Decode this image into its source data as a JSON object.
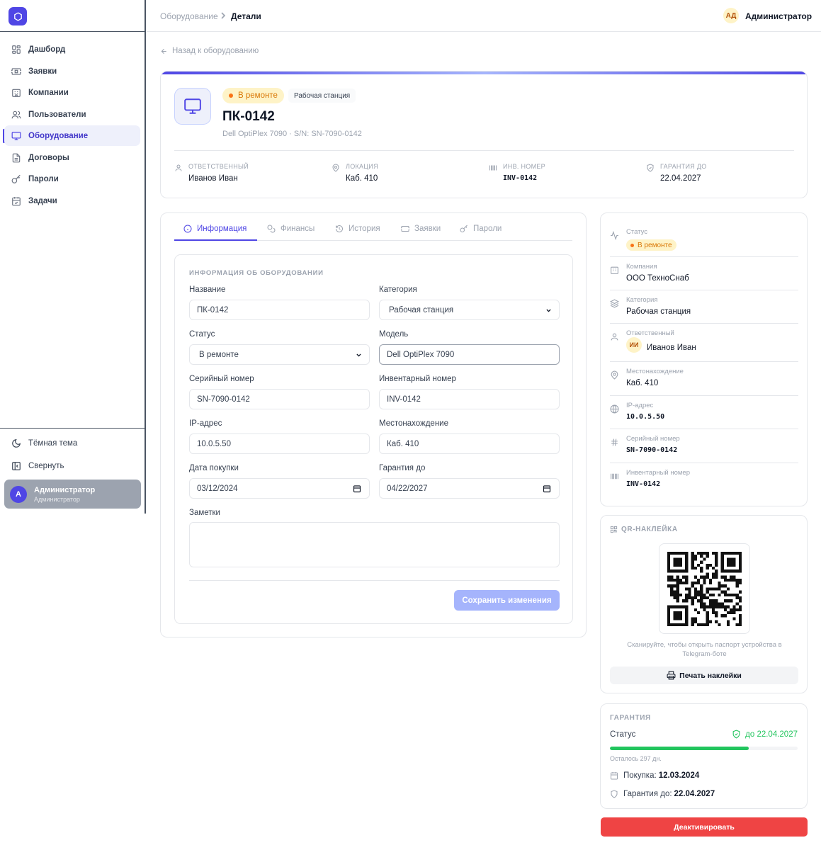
{
  "sidebar": {
    "items": [
      {
        "label": "Дашборд",
        "icon": "dashboard-icon"
      },
      {
        "label": "Заявки",
        "icon": "ticket-icon"
      },
      {
        "label": "Компании",
        "icon": "building-icon"
      },
      {
        "label": "Пользователи",
        "icon": "users-icon"
      },
      {
        "label": "Оборудование",
        "icon": "monitor-icon",
        "active": true
      },
      {
        "label": "Договоры",
        "icon": "document-icon"
      },
      {
        "label": "Пароли",
        "icon": "key-icon"
      },
      {
        "label": "Задачи",
        "icon": "calendar-check-icon"
      }
    ],
    "theme_label": "Тёмная тема",
    "collapse_label": "Свернуть",
    "user": {
      "initial": "A",
      "name": "Администратор",
      "role": "Администратор"
    }
  },
  "header": {
    "breadcrumb_parent": "Оборудование",
    "breadcrumb_current": "Детали",
    "user_initials": "АД",
    "user_name": "Администратор"
  },
  "back_link": "Назад к оборудованию",
  "hero": {
    "status": "В ремонте",
    "category": "Рабочая станция",
    "title": "ПК-0142",
    "subtitle": "Dell OptiPlex 7090 · S/N: SN-7090-0142",
    "stats": [
      {
        "label": "ОТВЕТСТВЕННЫЙ",
        "value": "Иванов Иван",
        "icon": "user-icon"
      },
      {
        "label": "ЛОКАЦИЯ",
        "value": "Каб. 410",
        "icon": "map-pin-icon"
      },
      {
        "label": "ИНВ. НОМЕР",
        "value": "INV-0142",
        "icon": "barcode-icon"
      },
      {
        "label": "ГАРАНТИЯ ДО",
        "value": "22.04.2027",
        "icon": "shield-icon"
      }
    ]
  },
  "tabs": [
    {
      "label": "Информация",
      "icon": "info-icon",
      "active": true
    },
    {
      "label": "Финансы",
      "icon": "coins-icon"
    },
    {
      "label": "История",
      "icon": "history-icon"
    },
    {
      "label": "Заявки",
      "icon": "ticket-icon"
    },
    {
      "label": "Пароли",
      "icon": "key-icon"
    }
  ],
  "form": {
    "title": "ИНФОРМАЦИЯ ОБ ОБОРУДОВАНИИ",
    "name": {
      "label": "Название",
      "value": "ПК-0142"
    },
    "category": {
      "label": "Категория",
      "value": "Рабочая станция"
    },
    "status": {
      "label": "Статус",
      "value": "В ремонте"
    },
    "model": {
      "label": "Модель",
      "value": "Dell OptiPlex 7090"
    },
    "serial": {
      "label": "Серийный номер",
      "value": "SN-7090-0142"
    },
    "inventory": {
      "label": "Инвентарный номер",
      "value": "INV-0142"
    },
    "ip": {
      "label": "IP-адрес",
      "value": "10.0.5.50"
    },
    "location": {
      "label": "Местонахождение",
      "value": "Каб. 410"
    },
    "purchase_date": {
      "label": "Дата покупки",
      "value": "03/12/2024"
    },
    "warranty_date": {
      "label": "Гарантия до",
      "value": "04/22/2027"
    },
    "notes": {
      "label": "Заметки",
      "value": ""
    },
    "save_label": "Сохранить изменения"
  },
  "info_panel": [
    {
      "label": "Статус",
      "value": "В ремонте",
      "icon": "activity-icon"
    },
    {
      "label": "Компания",
      "value": "ООО ТехноСнаб",
      "icon": "building-icon"
    },
    {
      "label": "Категория",
      "value": "Рабочая станция",
      "icon": "layers-icon"
    },
    {
      "label": "Ответственный",
      "value": "Иванов Иван",
      "avatar": "ИИ",
      "icon": "user-icon"
    },
    {
      "label": "Местонахождение",
      "value": "Каб. 410",
      "icon": "map-pin-icon"
    },
    {
      "label": "IP-адрес",
      "value": "10.0.5.50",
      "icon": "globe-icon"
    },
    {
      "label": "Серийный номер",
      "value": "SN-7090-0142",
      "icon": "hash-icon"
    },
    {
      "label": "Инвентарный номер",
      "value": "INV-0142",
      "icon": "barcode-icon"
    }
  ],
  "qr": {
    "title": "QR-НАКЛЕЙКА",
    "caption": "Сканируйте, чтобы открыть паспорт устройства в Telegram-боте",
    "print_label": "Печать наклейки"
  },
  "warranty": {
    "title": "ГАРАНТИЯ",
    "status_label": "Статус",
    "status_value": "до 22.04.2027",
    "progress": 0.74,
    "remaining": "Осталось 297 дн.",
    "purchase_label": "Покупка:",
    "purchase_value": "12.03.2024",
    "until_label": "Гарантия до:",
    "until_value": "22.04.2027"
  },
  "deactivate_label": "Деактивировать",
  "colors": {
    "accent": "#4f46e5",
    "status_repair": "#d97706",
    "success": "#22c55e",
    "danger": "#ef4444"
  }
}
